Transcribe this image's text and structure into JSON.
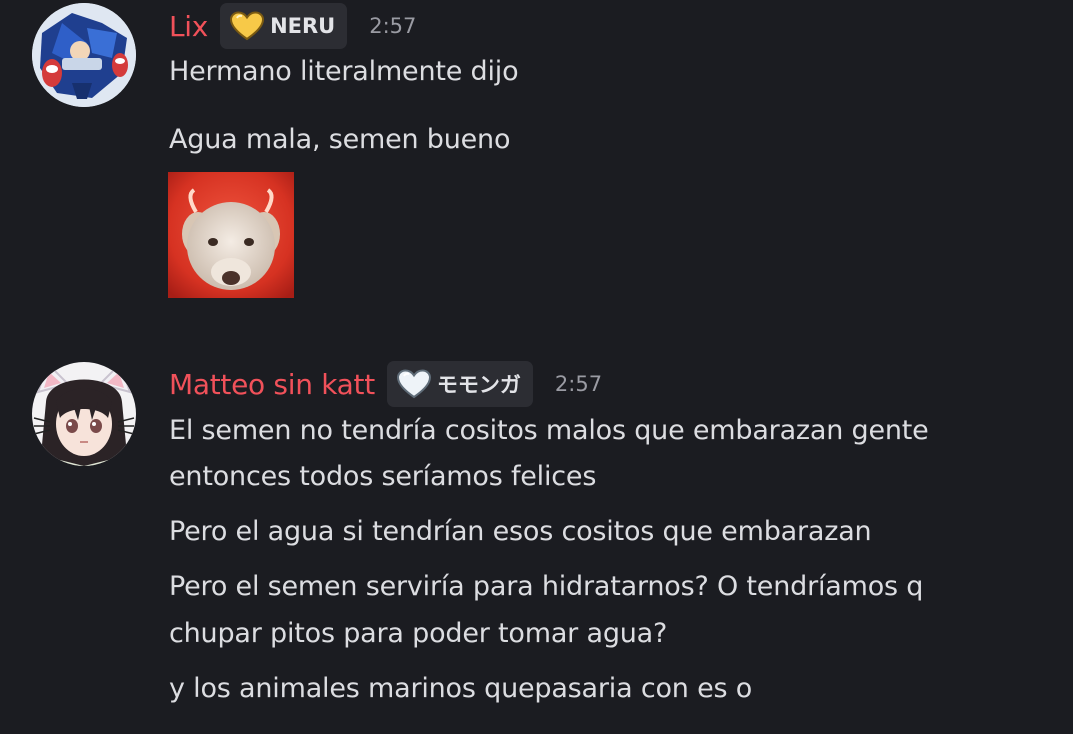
{
  "messages": [
    {
      "author": "Lix",
      "tag": "NERU",
      "tag_icon": "yellow-heart-icon",
      "tag_color": "#f7c948",
      "time": "2:57",
      "lines": [
        "Hermano literalmente dijo",
        "Agua mala, semen bueno"
      ],
      "attachment": "dog-image"
    },
    {
      "author": "Matteo sin katt",
      "tag": "モモンガ",
      "tag_icon": "white-heart-icon",
      "tag_color": "#eef3f8",
      "time": "2:57",
      "lines": [
        "El semen no tendría cositos malos que embarazan gente",
        "entonces todos seríamos felices",
        "Pero el agua si tendrían esos cositos que embarazan",
        "Pero el semen serviría para hidratarnos? O tendríamos q",
        "chupar pitos para poder tomar agua?",
        "y los animales marinos quepasaria con es o"
      ]
    }
  ],
  "colors": {
    "background": "#1b1c21",
    "username": "#f1515a",
    "tag_bg": "#2c2d33",
    "text": "#dcdde1",
    "timestamp": "#9a9ba3"
  }
}
